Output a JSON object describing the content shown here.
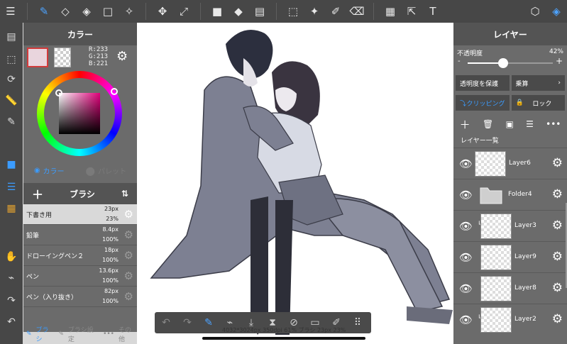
{
  "colors": {
    "accent": "#3b9cff",
    "panel_bg": "#6b6b6b",
    "toolbar_bg": "#474747",
    "main_color": "#e9d5dd"
  },
  "top_toolbar": {
    "icons": [
      "menu-icon",
      "brush-icon",
      "eraser-icon",
      "blur-eraser-icon",
      "rectangle-icon",
      "magic-brush-icon",
      "move-icon",
      "transform-icon",
      "fill-square-icon",
      "bucket-icon",
      "gradient-icon",
      "select-rect-icon",
      "magic-wand-icon",
      "select-pen-icon",
      "select-eraser-icon",
      "panel-icon",
      "select-move-icon",
      "text-icon",
      "materials-icon",
      "layers-icon"
    ],
    "text_tool_glyph": "T"
  },
  "color_panel": {
    "title": "カラー",
    "r": "R:233",
    "g": "G:213",
    "b": "B:221",
    "tab_color": "カラー",
    "tab_palette": "パレット"
  },
  "brush_panel": {
    "title": "ブラシ",
    "brushes": [
      {
        "name": "下書き用",
        "size": "23px",
        "opacity": "23%"
      },
      {
        "name": "鉛筆",
        "size": "8.4px",
        "opacity": "100%"
      },
      {
        "name": "ドローイングペン２",
        "size": "18px",
        "opacity": "100%"
      },
      {
        "name": "ペン",
        "size": "13.6px",
        "opacity": "100%"
      },
      {
        "name": "ペン（入り抜き）",
        "size": "82px",
        "opacity": "100%"
      }
    ],
    "footer_brush": "ブラシ",
    "footer_settings": "ブラシ設定",
    "footer_other": "その他"
  },
  "status_text": "4032*3024px 350dpi 61% ブラシ 23px 23%",
  "layer_panel": {
    "title": "レイヤー",
    "opacity_label": "不透明度",
    "opacity_value": "42%",
    "opacity_fraction": 0.42,
    "protect_alpha": "透明度を保護",
    "blend_mode": "乗算",
    "clipping": "クリッピング",
    "lock": "ロック",
    "list_label": "レイヤー一覧",
    "layers": [
      {
        "name": "Layer6"
      },
      {
        "name": "Folder4"
      },
      {
        "name": "Layer3"
      },
      {
        "name": "Layer9"
      },
      {
        "name": "Layer8"
      },
      {
        "name": "Layer2"
      }
    ]
  }
}
